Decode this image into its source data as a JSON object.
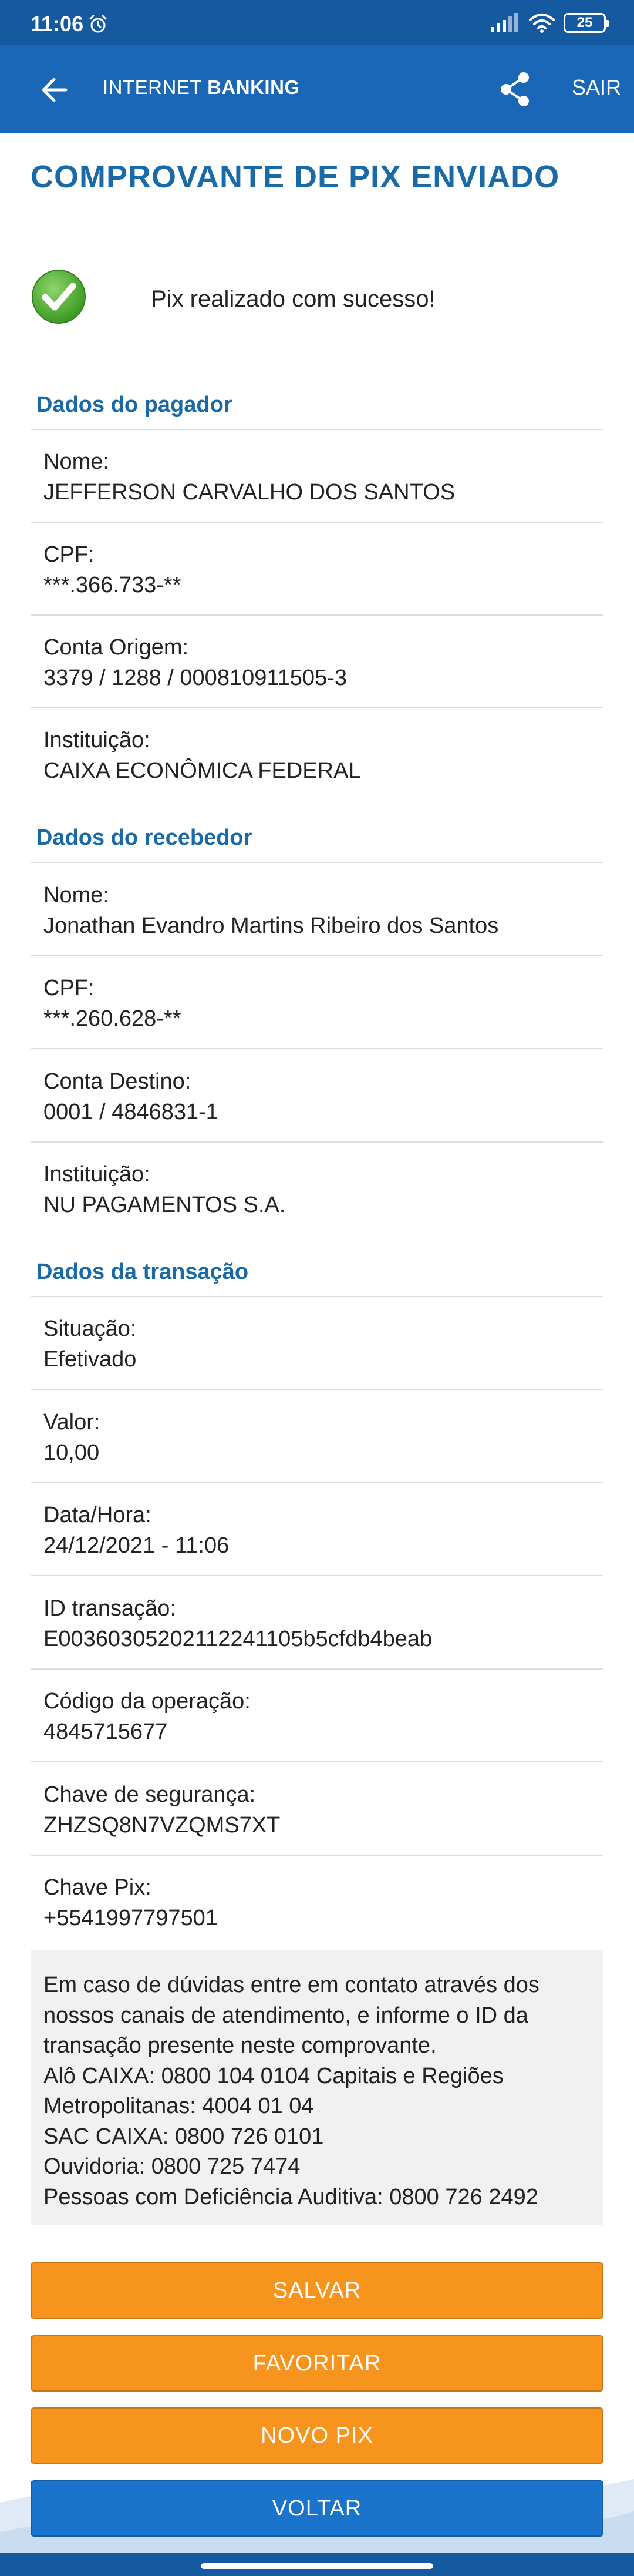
{
  "status_bar": {
    "time": "11:06",
    "battery": "25"
  },
  "app_bar": {
    "brand_regular": "INTERNET ",
    "brand_bold": "BANKING",
    "exit_label": "SAIR"
  },
  "page_title": "COMPROVANTE DE PIX ENVIADO",
  "success_message": "Pix realizado com sucesso!",
  "payer": {
    "title": "Dados do pagador",
    "fields": [
      {
        "label": "Nome:",
        "value": "JEFFERSON CARVALHO DOS SANTOS"
      },
      {
        "label": "CPF:",
        "value": "***.366.733-**"
      },
      {
        "label": "Conta Origem:",
        "value": "3379 / 1288 / 000810911505-3"
      },
      {
        "label": "Instituição:",
        "value": "CAIXA ECONÔMICA FEDERAL"
      }
    ]
  },
  "receiver": {
    "title": "Dados do recebedor",
    "fields": [
      {
        "label": "Nome:",
        "value": "Jonathan Evandro Martins Ribeiro dos Santos"
      },
      {
        "label": "CPF:",
        "value": "***.260.628-**"
      },
      {
        "label": "Conta Destino:",
        "value": "0001 / 4846831-1"
      },
      {
        "label": "Instituição:",
        "value": "NU PAGAMENTOS S.A."
      }
    ]
  },
  "transaction": {
    "title": "Dados da transação",
    "fields": [
      {
        "label": "Situação:",
        "value": "Efetivado"
      },
      {
        "label": "Valor:",
        "value": "10,00"
      },
      {
        "label": "Data/Hora:",
        "value": "24/12/2021 - 11:06"
      },
      {
        "label": "ID transação:",
        "value": "E00360305202112241105b5cfdb4beab"
      },
      {
        "label": "Código da operação:",
        "value": "4845715677"
      },
      {
        "label": "Chave de segurança:",
        "value": "ZHZSQ8N7VZQMS7XT"
      },
      {
        "label": "Chave Pix:",
        "value": "+5541997797501"
      }
    ]
  },
  "info_lines": [
    "Em caso de dúvidas entre em contato através dos",
    "nossos canais de atendimento, e informe o ID da",
    "transação presente neste comprovante.",
    "Alô CAIXA: 0800 104 0104 Capitais e Regiões",
    "Metropolitanas: 4004 01 04",
    "SAC CAIXA: 0800 726 0101",
    "Ouvidoria: 0800 725 7474",
    "Pessoas com Deficiência Auditiva: 0800 726 2492"
  ],
  "buttons": {
    "save": "SALVAR",
    "favorite": "FAVORITAR",
    "new_pix": "NOVO PIX",
    "back": "VOLTAR"
  },
  "colors": {
    "primary_blue": "#1b67b7",
    "title_blue": "#1a6aa8",
    "orange": "#f7941d",
    "button_blue": "#1b74cc",
    "success_green": "#4cae32"
  },
  "icons": {
    "back": "arrow-left-icon",
    "share": "share-icon",
    "alarm": "alarm-icon",
    "success": "check-circle-icon"
  }
}
